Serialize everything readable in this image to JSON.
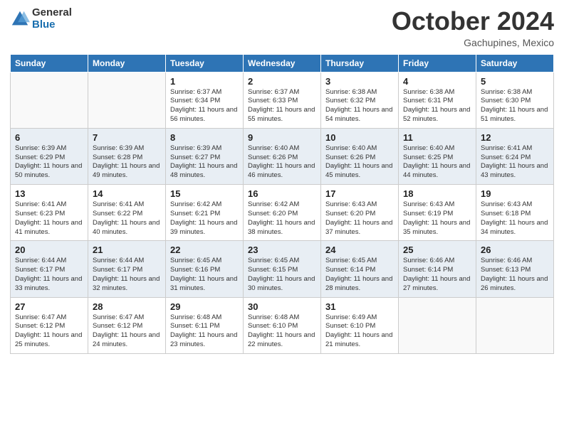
{
  "header": {
    "logo_general": "General",
    "logo_blue": "Blue",
    "month": "October 2024",
    "location": "Gachupines, Mexico"
  },
  "weekdays": [
    "Sunday",
    "Monday",
    "Tuesday",
    "Wednesday",
    "Thursday",
    "Friday",
    "Saturday"
  ],
  "weeks": [
    [
      {
        "day": "",
        "sunrise": "",
        "sunset": "",
        "daylight": ""
      },
      {
        "day": "",
        "sunrise": "",
        "sunset": "",
        "daylight": ""
      },
      {
        "day": "1",
        "sunrise": "Sunrise: 6:37 AM",
        "sunset": "Sunset: 6:34 PM",
        "daylight": "Daylight: 11 hours and 56 minutes."
      },
      {
        "day": "2",
        "sunrise": "Sunrise: 6:37 AM",
        "sunset": "Sunset: 6:33 PM",
        "daylight": "Daylight: 11 hours and 55 minutes."
      },
      {
        "day": "3",
        "sunrise": "Sunrise: 6:38 AM",
        "sunset": "Sunset: 6:32 PM",
        "daylight": "Daylight: 11 hours and 54 minutes."
      },
      {
        "day": "4",
        "sunrise": "Sunrise: 6:38 AM",
        "sunset": "Sunset: 6:31 PM",
        "daylight": "Daylight: 11 hours and 52 minutes."
      },
      {
        "day": "5",
        "sunrise": "Sunrise: 6:38 AM",
        "sunset": "Sunset: 6:30 PM",
        "daylight": "Daylight: 11 hours and 51 minutes."
      }
    ],
    [
      {
        "day": "6",
        "sunrise": "Sunrise: 6:39 AM",
        "sunset": "Sunset: 6:29 PM",
        "daylight": "Daylight: 11 hours and 50 minutes."
      },
      {
        "day": "7",
        "sunrise": "Sunrise: 6:39 AM",
        "sunset": "Sunset: 6:28 PM",
        "daylight": "Daylight: 11 hours and 49 minutes."
      },
      {
        "day": "8",
        "sunrise": "Sunrise: 6:39 AM",
        "sunset": "Sunset: 6:27 PM",
        "daylight": "Daylight: 11 hours and 48 minutes."
      },
      {
        "day": "9",
        "sunrise": "Sunrise: 6:40 AM",
        "sunset": "Sunset: 6:26 PM",
        "daylight": "Daylight: 11 hours and 46 minutes."
      },
      {
        "day": "10",
        "sunrise": "Sunrise: 6:40 AM",
        "sunset": "Sunset: 6:26 PM",
        "daylight": "Daylight: 11 hours and 45 minutes."
      },
      {
        "day": "11",
        "sunrise": "Sunrise: 6:40 AM",
        "sunset": "Sunset: 6:25 PM",
        "daylight": "Daylight: 11 hours and 44 minutes."
      },
      {
        "day": "12",
        "sunrise": "Sunrise: 6:41 AM",
        "sunset": "Sunset: 6:24 PM",
        "daylight": "Daylight: 11 hours and 43 minutes."
      }
    ],
    [
      {
        "day": "13",
        "sunrise": "Sunrise: 6:41 AM",
        "sunset": "Sunset: 6:23 PM",
        "daylight": "Daylight: 11 hours and 41 minutes."
      },
      {
        "day": "14",
        "sunrise": "Sunrise: 6:41 AM",
        "sunset": "Sunset: 6:22 PM",
        "daylight": "Daylight: 11 hours and 40 minutes."
      },
      {
        "day": "15",
        "sunrise": "Sunrise: 6:42 AM",
        "sunset": "Sunset: 6:21 PM",
        "daylight": "Daylight: 11 hours and 39 minutes."
      },
      {
        "day": "16",
        "sunrise": "Sunrise: 6:42 AM",
        "sunset": "Sunset: 6:20 PM",
        "daylight": "Daylight: 11 hours and 38 minutes."
      },
      {
        "day": "17",
        "sunrise": "Sunrise: 6:43 AM",
        "sunset": "Sunset: 6:20 PM",
        "daylight": "Daylight: 11 hours and 37 minutes."
      },
      {
        "day": "18",
        "sunrise": "Sunrise: 6:43 AM",
        "sunset": "Sunset: 6:19 PM",
        "daylight": "Daylight: 11 hours and 35 minutes."
      },
      {
        "day": "19",
        "sunrise": "Sunrise: 6:43 AM",
        "sunset": "Sunset: 6:18 PM",
        "daylight": "Daylight: 11 hours and 34 minutes."
      }
    ],
    [
      {
        "day": "20",
        "sunrise": "Sunrise: 6:44 AM",
        "sunset": "Sunset: 6:17 PM",
        "daylight": "Daylight: 11 hours and 33 minutes."
      },
      {
        "day": "21",
        "sunrise": "Sunrise: 6:44 AM",
        "sunset": "Sunset: 6:17 PM",
        "daylight": "Daylight: 11 hours and 32 minutes."
      },
      {
        "day": "22",
        "sunrise": "Sunrise: 6:45 AM",
        "sunset": "Sunset: 6:16 PM",
        "daylight": "Daylight: 11 hours and 31 minutes."
      },
      {
        "day": "23",
        "sunrise": "Sunrise: 6:45 AM",
        "sunset": "Sunset: 6:15 PM",
        "daylight": "Daylight: 11 hours and 30 minutes."
      },
      {
        "day": "24",
        "sunrise": "Sunrise: 6:45 AM",
        "sunset": "Sunset: 6:14 PM",
        "daylight": "Daylight: 11 hours and 28 minutes."
      },
      {
        "day": "25",
        "sunrise": "Sunrise: 6:46 AM",
        "sunset": "Sunset: 6:14 PM",
        "daylight": "Daylight: 11 hours and 27 minutes."
      },
      {
        "day": "26",
        "sunrise": "Sunrise: 6:46 AM",
        "sunset": "Sunset: 6:13 PM",
        "daylight": "Daylight: 11 hours and 26 minutes."
      }
    ],
    [
      {
        "day": "27",
        "sunrise": "Sunrise: 6:47 AM",
        "sunset": "Sunset: 6:12 PM",
        "daylight": "Daylight: 11 hours and 25 minutes."
      },
      {
        "day": "28",
        "sunrise": "Sunrise: 6:47 AM",
        "sunset": "Sunset: 6:12 PM",
        "daylight": "Daylight: 11 hours and 24 minutes."
      },
      {
        "day": "29",
        "sunrise": "Sunrise: 6:48 AM",
        "sunset": "Sunset: 6:11 PM",
        "daylight": "Daylight: 11 hours and 23 minutes."
      },
      {
        "day": "30",
        "sunrise": "Sunrise: 6:48 AM",
        "sunset": "Sunset: 6:10 PM",
        "daylight": "Daylight: 11 hours and 22 minutes."
      },
      {
        "day": "31",
        "sunrise": "Sunrise: 6:49 AM",
        "sunset": "Sunset: 6:10 PM",
        "daylight": "Daylight: 11 hours and 21 minutes."
      },
      {
        "day": "",
        "sunrise": "",
        "sunset": "",
        "daylight": ""
      },
      {
        "day": "",
        "sunrise": "",
        "sunset": "",
        "daylight": ""
      }
    ]
  ]
}
